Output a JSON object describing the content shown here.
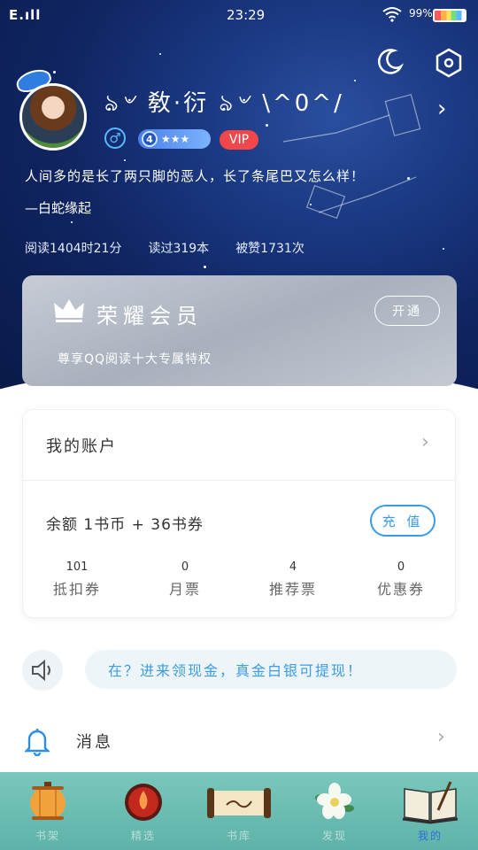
{
  "status_bar": {
    "signal": "E.ıll",
    "time": "23:29",
    "battery": "99%"
  },
  "profile": {
    "nickname": "ঌ৺ 敎·衍 ঌ৺ \\^0^/",
    "level": "4",
    "level_stars": "★★★",
    "vip": "VIP",
    "gender_symbol": "♂",
    "motto": "人间多的是长了两只脚的恶人，长了条尾巴又怎么样！",
    "motto_source": "—白蛇缘起",
    "stats": [
      "阅读1404时21分",
      "读过319本",
      "被赞1731次"
    ]
  },
  "vip_card": {
    "title": "荣耀会员",
    "subtitle": "尊享QQ阅读十大专属特权",
    "button": "开通"
  },
  "account": {
    "title": "我的账户",
    "balance": "余额  1书币 + 36书券",
    "recharge": "充 值",
    "tickets": [
      {
        "value": "101",
        "name": "抵扣券"
      },
      {
        "value": "0",
        "name": "月票"
      },
      {
        "value": "4",
        "name": "推荐票"
      },
      {
        "value": "0",
        "name": "优惠券"
      }
    ]
  },
  "notice": "在？进来领现金，真金白银可提现！",
  "messages": {
    "label": "消息"
  },
  "bottom_nav": [
    {
      "label": "书架",
      "icon": "lantern-icon",
      "active": false
    },
    {
      "label": "精选",
      "icon": "fire-orb-icon",
      "active": false
    },
    {
      "label": "书库",
      "icon": "scroll-icon",
      "active": false
    },
    {
      "label": "发现",
      "icon": "flower-icon",
      "active": false
    },
    {
      "label": "我的",
      "icon": "open-book-icon",
      "active": true
    }
  ],
  "colors": {
    "accent": "#3a9be8",
    "vip_red": "#f0474b",
    "nav_bg": "#79c7bd"
  }
}
